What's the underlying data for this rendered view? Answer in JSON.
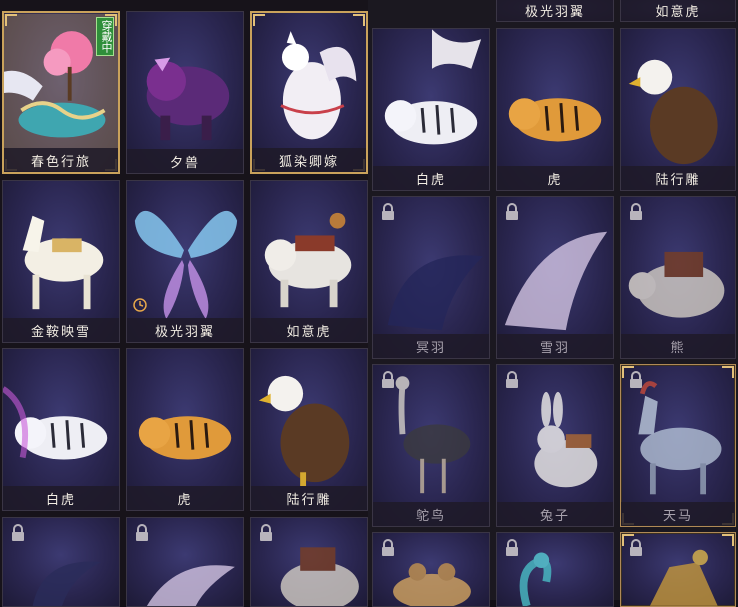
{
  "left_grid": {
    "cards": [
      {
        "label": "春色行旅",
        "locked": false,
        "badge": "穿戴中",
        "selected": true
      },
      {
        "label": "夕兽",
        "locked": false
      },
      {
        "label": "狐染卿嫁",
        "locked": false
      },
      {
        "label": "金鞍映雪",
        "locked": false
      },
      {
        "label": "极光羽翼",
        "locked": false,
        "timer": true
      },
      {
        "label": "如意虎",
        "locked": false
      },
      {
        "label": "白虎",
        "locked": false
      },
      {
        "label": "虎",
        "locked": false
      },
      {
        "label": "陆行雕",
        "locked": false
      },
      {
        "label": "",
        "locked": true
      },
      {
        "label": "",
        "locked": true
      },
      {
        "label": "",
        "locked": true
      }
    ]
  },
  "right_grid": {
    "top_strip_labels": [
      "极光羽翼",
      "如意虎"
    ],
    "cards": [
      {
        "label": "白虎",
        "locked": false
      },
      {
        "label": "虎",
        "locked": false
      },
      {
        "label": "陆行雕",
        "locked": false
      },
      {
        "label": "冥羽",
        "locked": true
      },
      {
        "label": "雪羽",
        "locked": true
      },
      {
        "label": "熊",
        "locked": true
      },
      {
        "label": "鸵鸟",
        "locked": true
      },
      {
        "label": "兔子",
        "locked": true
      },
      {
        "label": "天马",
        "locked": true,
        "framed": true
      },
      {
        "label": "",
        "locked": true
      },
      {
        "label": "",
        "locked": true
      },
      {
        "label": "",
        "locked": false,
        "framed": true
      }
    ]
  },
  "colors": {
    "card_bg": "#2a2650",
    "frame_gold": "#c9a25b",
    "badge_green": "#2f8f3a",
    "label_text": "#f1ece2"
  },
  "icons": [
    "lock-icon",
    "timer-icon"
  ]
}
